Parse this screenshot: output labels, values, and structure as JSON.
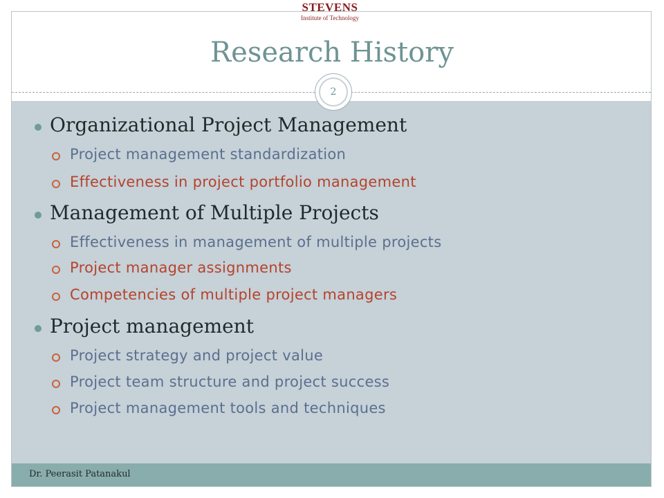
{
  "header": {
    "logo_main": "STEVENS",
    "logo_sub": "Institute of Technology",
    "title": "Research History",
    "page_number": "2"
  },
  "sections": [
    {
      "heading": "Organizational Project Management",
      "items": [
        "Project management standardization",
        "Effectiveness in project portfolio management"
      ]
    },
    {
      "heading": "Management of Multiple Projects",
      "items": [
        "Effectiveness in management of multiple projects",
        "Project manager assignments",
        "Competencies of multiple project managers"
      ]
    },
    {
      "heading": "Project management",
      "items": [
        "Project strategy and project value",
        "Project team structure and project success",
        "Project management tools and techniques"
      ]
    }
  ],
  "footer": {
    "author": "Dr. Peerasit Patanakul"
  },
  "colors": {
    "accent": "#6f9393",
    "sub_text_blue": "#5b6f8e",
    "sub_text_red": "#b5432b",
    "content_background": "#c6d1d8",
    "footer_background": "#89adac",
    "logo": "#8a1c1c"
  }
}
